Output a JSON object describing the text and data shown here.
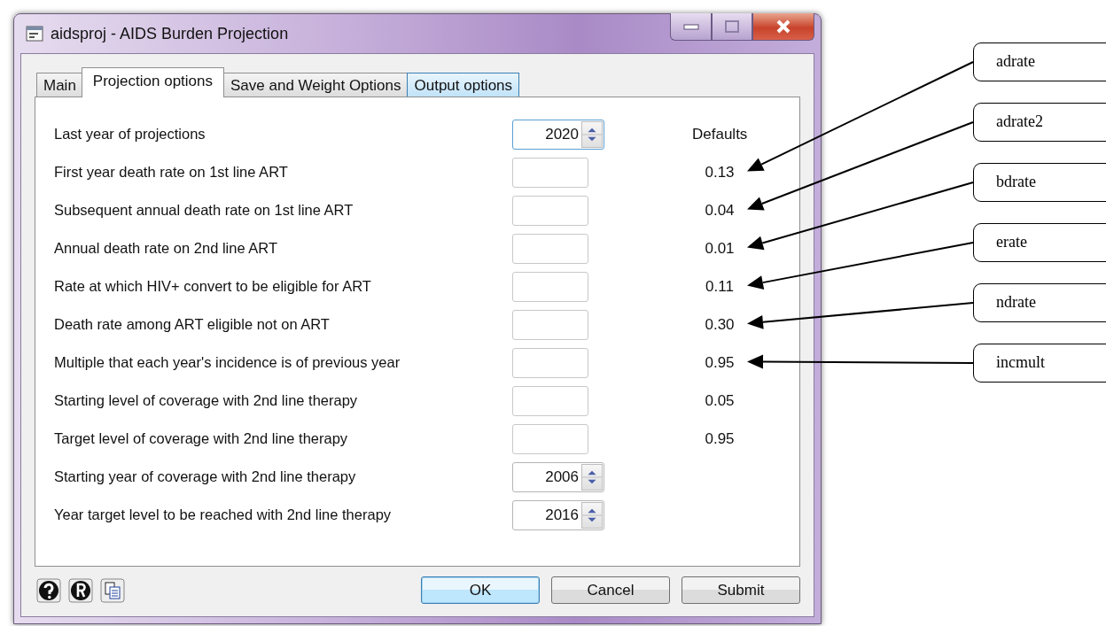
{
  "window": {
    "title": "aidsproj - AIDS Burden Projection"
  },
  "tabs": [
    {
      "label": "Main",
      "selected": false,
      "highlighted": false
    },
    {
      "label": "Projection options",
      "selected": true,
      "highlighted": false
    },
    {
      "label": "Save and Weight Options",
      "selected": false,
      "highlighted": false
    },
    {
      "label": "Output options",
      "selected": false,
      "highlighted": true
    }
  ],
  "defaults_heading": "Defaults",
  "fields": [
    {
      "label": "Last year of projections",
      "kind": "spinner",
      "value": "2020",
      "focused": true
    },
    {
      "label": "First year death rate on 1st line ART",
      "kind": "text",
      "focused": false,
      "default": "0.13",
      "callout": "adrate"
    },
    {
      "label": "Subsequent annual death rate on 1st line ART",
      "kind": "text",
      "focused": false,
      "default": "0.04",
      "callout": "adrate2"
    },
    {
      "label": "Annual death rate on 2nd line ART",
      "kind": "text",
      "focused": false,
      "default": "0.01",
      "callout": "bdrate"
    },
    {
      "label": "Rate at which HIV+ convert to be eligible for ART",
      "kind": "text",
      "focused": false,
      "default": "0.11",
      "callout": "erate"
    },
    {
      "label": "Death rate among ART eligible not on ART",
      "kind": "text",
      "focused": false,
      "default": "0.30",
      "callout": "ndrate"
    },
    {
      "label": "Multiple that each year's incidence is of previous year",
      "kind": "text",
      "focused": false,
      "default": "0.95",
      "callout": "incmult"
    },
    {
      "label": "Starting level of coverage with 2nd line therapy",
      "kind": "text",
      "focused": false,
      "default": "0.05"
    },
    {
      "label": "Target level of coverage with 2nd line therapy",
      "kind": "text",
      "focused": false,
      "default": "0.95"
    },
    {
      "label": "Starting year of coverage with 2nd line therapy",
      "kind": "spinner",
      "value": "2006",
      "focused": false
    },
    {
      "label": "Year target level to be reached with 2nd line therapy",
      "kind": "spinner",
      "value": "2016",
      "focused": false
    }
  ],
  "buttons": [
    {
      "label": "OK",
      "default": true
    },
    {
      "label": "Cancel",
      "default": false
    },
    {
      "label": "Submit",
      "default": false
    }
  ]
}
